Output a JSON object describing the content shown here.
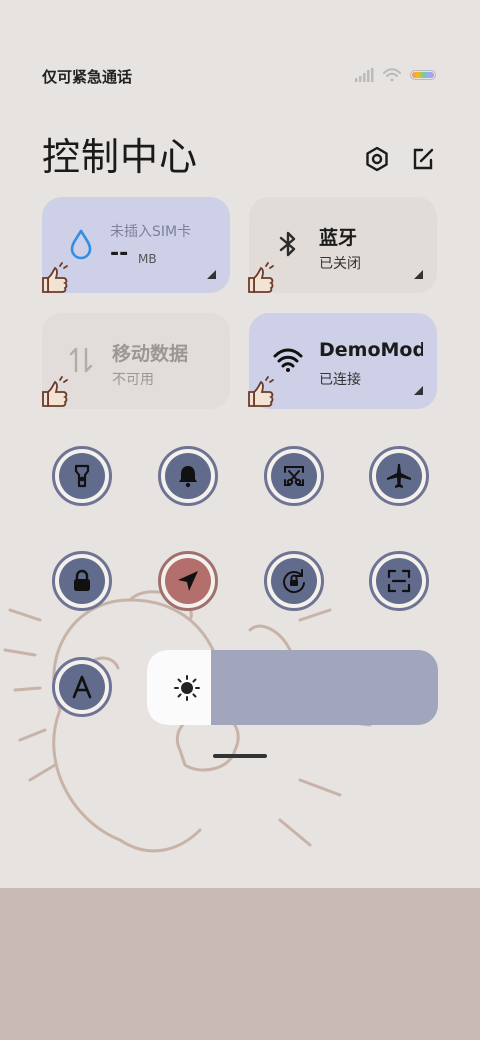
{
  "status_bar": {
    "carrier_text": "仅可紧急通话",
    "icons": [
      "signal-icon",
      "wifi-icon",
      "battery-icon"
    ]
  },
  "header": {
    "title": "控制中心",
    "icons": [
      "settings-icon",
      "edit-icon"
    ]
  },
  "tiles": [
    {
      "id": "data-usage",
      "main": "--",
      "unit": "MB",
      "sub": "未插入SIM卡",
      "state": "active",
      "icon": "water-drop-icon"
    },
    {
      "id": "bluetooth",
      "main": "蓝牙",
      "sub": "已关闭",
      "state": "inactive",
      "icon": "bluetooth-icon"
    },
    {
      "id": "mobile-data",
      "main": "移动数据",
      "sub": "不可用",
      "state": "inactive",
      "icon": "mobile-data-icon"
    },
    {
      "id": "wifi",
      "main": "DemoMod",
      "sub": "已连接",
      "state": "active",
      "icon": "wifi-icon"
    }
  ],
  "toggles": [
    {
      "id": "flashlight",
      "icon": "flashlight-icon",
      "on": false
    },
    {
      "id": "silent",
      "icon": "bell-icon",
      "on": false
    },
    {
      "id": "screenshot",
      "icon": "screenshot-icon",
      "on": false
    },
    {
      "id": "airplane",
      "icon": "airplane-icon",
      "on": false
    },
    {
      "id": "lock-screen",
      "icon": "lock-icon",
      "on": false
    },
    {
      "id": "location",
      "icon": "location-arrow-icon",
      "on": true
    },
    {
      "id": "rotation-lock",
      "icon": "rotation-lock-icon",
      "on": false
    },
    {
      "id": "scanner",
      "icon": "scan-icon",
      "on": false
    },
    {
      "id": "reading-mode",
      "icon": "font-a-icon",
      "on": false
    }
  ],
  "brightness": {
    "level_fraction": 0.22,
    "icon": "sun-icon"
  },
  "colors": {
    "active_tile": "#cdd0e6",
    "inactive_tile": "#e2dcd9",
    "toggle_core": "#616b8c",
    "toggle_on": "#b26f6c",
    "slider_track": "#a2a6bd"
  }
}
